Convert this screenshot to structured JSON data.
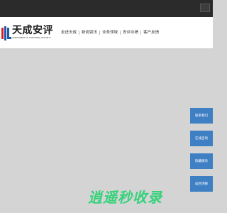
{
  "topbar": {
    "links": [
      "",
      ""
    ],
    "search_icon": "search-icon"
  },
  "logo": {
    "title": "天成安评",
    "subtitle": "ASSESSMENT OF TIANCHENG SECURITY",
    "colors": {
      "red": "#d9232a",
      "blue": "#1f5aa8"
    }
  },
  "nav": {
    "items": [
      {
        "label": "走进天成"
      },
      {
        "label": "新闻资讯"
      },
      {
        "label": "业务领域"
      },
      {
        "label": "安评业绩"
      },
      {
        "label": "客户反馈"
      }
    ]
  },
  "sidebar": {
    "items": [
      {
        "label": "联系我们"
      },
      {
        "label": "在线咨询"
      },
      {
        "label": "隐藏模块"
      },
      {
        "label": "返回顶部"
      }
    ],
    "color": "#3f7fc4"
  },
  "watermark": {
    "text": "逍遥秒收录",
    "color": "#35d27a"
  }
}
